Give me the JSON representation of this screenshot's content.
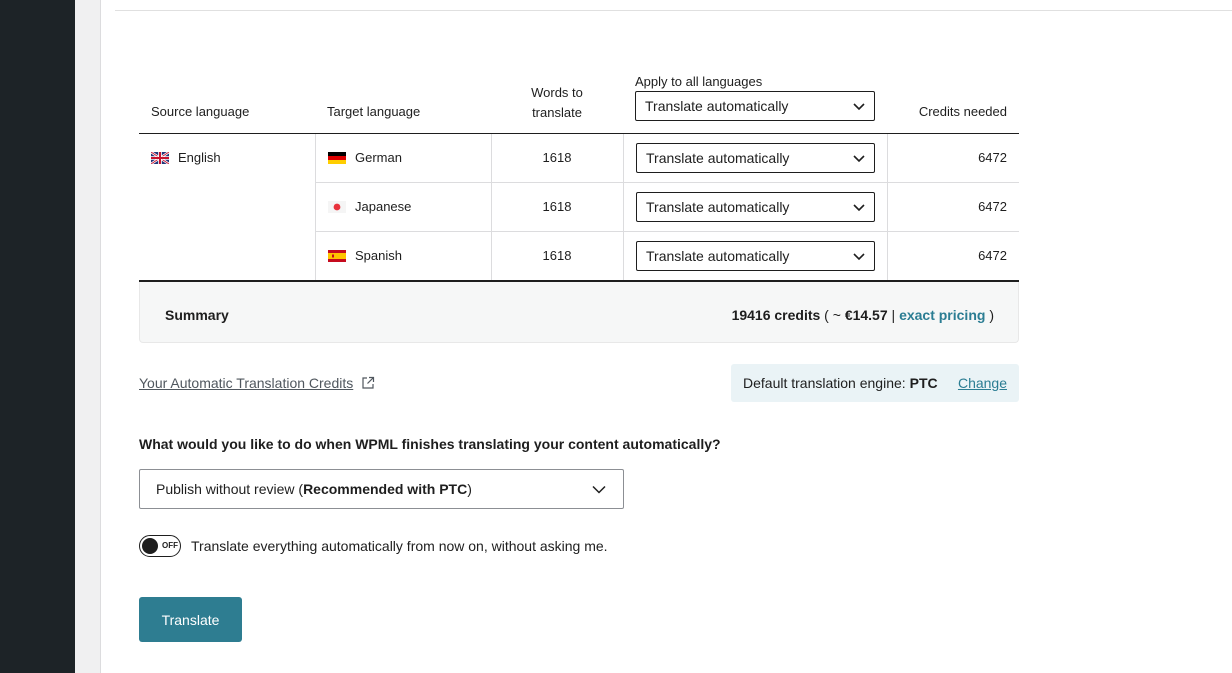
{
  "table": {
    "headers": {
      "source_language": "Source language",
      "target_language": "Target language",
      "words_line1": "Words to",
      "words_line2": "translate",
      "apply_to_all": "Apply to all languages",
      "credits_needed": "Credits needed"
    },
    "apply_all_value": "Translate automatically",
    "source": {
      "name": "English",
      "flag": "uk-flag-icon"
    },
    "rows": [
      {
        "language": "German",
        "flag": "germany-flag-icon",
        "words": "1618",
        "method": "Translate automatically",
        "credits": "6472"
      },
      {
        "language": "Japanese",
        "flag": "japan-flag-icon",
        "words": "1618",
        "method": "Translate automatically",
        "credits": "6472"
      },
      {
        "language": "Spanish",
        "flag": "spain-flag-icon",
        "words": "1618",
        "method": "Translate automatically",
        "credits": "6472"
      }
    ]
  },
  "summary": {
    "label": "Summary",
    "credits": "19416 credits",
    "open_paren": " ( ~ ",
    "price": "€14.57",
    "separator": " | ",
    "pricing_link": "exact pricing",
    "close_paren": " )"
  },
  "credits_link": "Your Automatic Translation Credits",
  "engine": {
    "label": "Default translation engine:",
    "value": "PTC",
    "change": "Change"
  },
  "question": "What would you like to do when WPML finishes translating your content automatically?",
  "publish_select": {
    "prefix": "Publish without review (",
    "bold": "Recommended with PTC",
    "suffix": ")"
  },
  "toggle": {
    "state": "OFF",
    "label": "Translate everything automatically from now on, without asking me."
  },
  "translate_button": "Translate",
  "colors": {
    "accent": "#2e7d91",
    "link": "#2b7d93",
    "sidebar": "#1d2327"
  }
}
